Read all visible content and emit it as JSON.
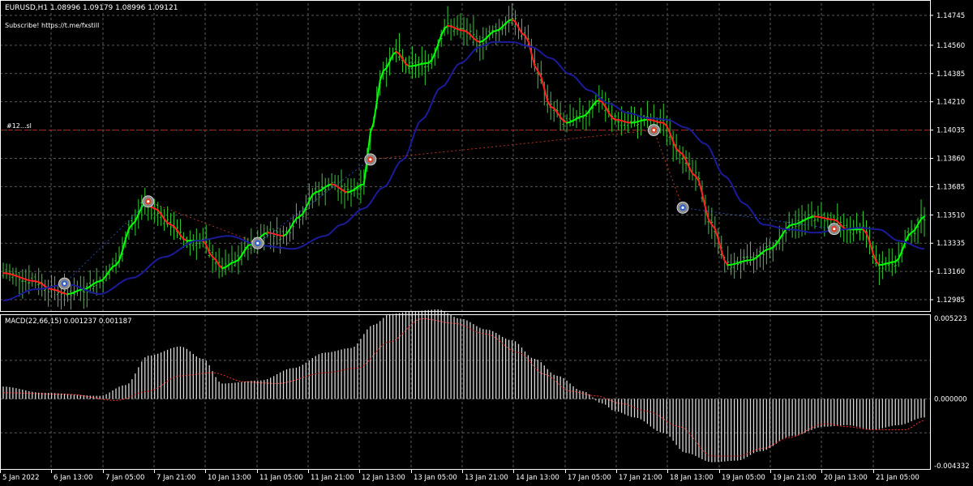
{
  "header": {
    "symbol_line": "EURUSD,H1  1.08996 1.09179 1.08996 1.09121",
    "subscribe_text": "Subscribe! https://t.me/fxstill"
  },
  "level": {
    "label": "#12...sl",
    "price": 1.14035
  },
  "colors": {
    "background": "#000000",
    "grid": "#5a5a5a",
    "bars": "#33cc33",
    "up_line": "#00ff00",
    "down_line": "#ff2020",
    "ma": "#1b1b9a",
    "macd_hist": "#d8d8d8",
    "signal": "#ff3030",
    "level": "#b02020",
    "sell_marker": "#e04020",
    "buy_marker": "#3060d0"
  },
  "chart_data": [
    {
      "type": "line",
      "title": "EURUSD,H1",
      "ylim": [
        1.1291,
        1.1482
      ],
      "y_ticks": [
        1.14745,
        1.1456,
        1.14385,
        1.1421,
        1.14035,
        1.1386,
        1.13685,
        1.1351,
        1.13335,
        1.1316,
        1.12985
      ],
      "y_tick_labels": [
        "1.14745",
        "1.14560",
        "1.14385",
        "1.14210",
        "1.14035",
        "1.13860",
        "1.13685",
        "1.13510",
        "1.13335",
        "1.13160",
        "1.12985"
      ],
      "x_ticks": [
        "5 Jan 2022",
        "6 Jan 13:00",
        "7 Jan 05:00",
        "7 Jan 21:00",
        "10 Jan 13:00",
        "11 Jan 05:00",
        "11 Jan 21:00",
        "12 Jan 13:00",
        "13 Jan 05:00",
        "13 Jan 21:00",
        "14 Jan 13:00",
        "17 Jan 05:00",
        "17 Jan 21:00",
        "18 Jan 13:00",
        "19 Jan 05:00",
        "19 Jan 21:00",
        "20 Jan 13:00",
        "21 Jan 05:00"
      ],
      "x_tick_index": [
        0,
        16,
        32,
        48,
        64,
        80,
        96,
        112,
        128,
        144,
        160,
        176,
        192,
        208,
        224,
        240,
        256,
        272
      ],
      "n_bars": 287,
      "series": [
        {
          "key": "smooth_price",
          "knots_index": [
            0,
            10,
            15,
            20,
            25,
            30,
            35,
            40,
            44,
            47,
            52,
            57,
            62,
            65,
            68,
            72,
            77,
            82,
            87,
            92,
            97,
            102,
            107,
            112,
            114,
            118,
            122,
            126,
            132,
            138,
            143,
            148,
            153,
            158,
            162,
            166,
            170,
            175,
            180,
            185,
            190,
            195,
            200,
            205,
            210,
            215,
            220,
            225,
            232,
            238,
            245,
            252,
            258,
            262,
            267,
            272,
            277,
            282,
            286
          ],
          "knots_value": [
            1.1315,
            1.131,
            1.1305,
            1.1302,
            1.1305,
            1.131,
            1.132,
            1.1345,
            1.1358,
            1.1355,
            1.1345,
            1.1335,
            1.1335,
            1.1325,
            1.1318,
            1.1322,
            1.1333,
            1.134,
            1.1338,
            1.135,
            1.1365,
            1.137,
            1.1365,
            1.137,
            1.1402,
            1.144,
            1.1452,
            1.1443,
            1.1445,
            1.1468,
            1.1465,
            1.1458,
            1.1465,
            1.1472,
            1.1462,
            1.144,
            1.1418,
            1.1408,
            1.1412,
            1.1422,
            1.141,
            1.1408,
            1.141,
            1.1408,
            1.139,
            1.1375,
            1.1345,
            1.132,
            1.1323,
            1.133,
            1.1345,
            1.135,
            1.1348,
            1.1342,
            1.1342,
            1.132,
            1.1322,
            1.134,
            1.135
          ]
        },
        {
          "key": "moving_average",
          "knots_index": [
            0,
            10,
            20,
            30,
            40,
            50,
            60,
            70,
            80,
            90,
            100,
            105,
            112,
            118,
            124,
            130,
            136,
            142,
            148,
            152,
            158,
            164,
            170,
            176,
            182,
            188,
            194,
            200,
            206,
            212,
            218,
            224,
            230,
            236,
            244,
            252,
            260,
            266,
            272,
            278,
            286
          ],
          "knots_value": [
            1.1298,
            1.1305,
            1.1308,
            1.1302,
            1.1312,
            1.1325,
            1.1335,
            1.1338,
            1.1332,
            1.133,
            1.1338,
            1.1345,
            1.1355,
            1.1368,
            1.1385,
            1.141,
            1.143,
            1.1445,
            1.1455,
            1.1458,
            1.1458,
            1.1455,
            1.1448,
            1.1438,
            1.1428,
            1.142,
            1.1414,
            1.1411,
            1.141,
            1.1405,
            1.1395,
            1.1375,
            1.1358,
            1.1345,
            1.1342,
            1.134,
            1.1342,
            1.1343,
            1.1342,
            1.1335,
            1.133
          ]
        }
      ],
      "markers": [
        {
          "kind": "buy",
          "index": 19,
          "value": 1.13085
        },
        {
          "kind": "sell",
          "index": 45,
          "value": 1.13593
        },
        {
          "kind": "buy",
          "index": 79,
          "value": 1.13335
        },
        {
          "kind": "sell",
          "index": 114,
          "value": 1.13853
        },
        {
          "kind": "sell",
          "index": 202,
          "value": 1.14035
        },
        {
          "kind": "buy",
          "index": 211,
          "value": 1.13555
        },
        {
          "kind": "sell",
          "index": 258,
          "value": 1.13423
        }
      ]
    },
    {
      "type": "bar",
      "title": "MACD(22,66,15) 0.001237 0.001187",
      "ylim": [
        -0.004332,
        0.005223
      ],
      "y_ticks": [
        0.005223,
        0.0,
        -0.004332
      ],
      "y_tick_labels": [
        "0.005223",
        "0.000000",
        "-0.004332"
      ],
      "series": [
        {
          "key": "macd_hist",
          "knots_index": [
            0,
            12,
            30,
            38,
            45,
            55,
            62,
            68,
            80,
            90,
            100,
            108,
            115,
            120,
            128,
            135,
            142,
            150,
            158,
            165,
            172,
            180,
            186,
            190,
            196,
            205,
            212,
            220,
            228,
            235,
            245,
            255,
            262,
            270,
            278,
            286
          ],
          "knots_value": [
            0.0008,
            0.0004,
            0.0002,
            0.0009,
            0.0028,
            0.0034,
            0.0026,
            0.001,
            0.0012,
            0.002,
            0.003,
            0.0033,
            0.0048,
            0.0055,
            0.0057,
            0.0058,
            0.0052,
            0.0045,
            0.0038,
            0.0026,
            0.0015,
            0.0005,
            -0.0003,
            -0.0008,
            -0.0012,
            -0.0022,
            -0.0035,
            -0.0041,
            -0.004,
            -0.0034,
            -0.0024,
            -0.0018,
            -0.0017,
            -0.002,
            -0.0017,
            -0.0012
          ]
        },
        {
          "key": "signal",
          "knots_index": [
            0,
            20,
            35,
            45,
            55,
            65,
            75,
            85,
            100,
            110,
            120,
            130,
            140,
            150,
            160,
            168,
            176,
            184,
            192,
            200,
            210,
            220,
            228,
            236,
            244,
            255,
            262,
            270,
            280,
            286
          ],
          "knots_value": [
            0.0004,
            0.0003,
            -0.0001,
            0.0005,
            0.0015,
            0.0017,
            0.0011,
            0.001,
            0.0017,
            0.002,
            0.0037,
            0.0052,
            0.0049,
            0.0042,
            0.003,
            0.0016,
            0.0005,
            0.0002,
            -0.0003,
            -0.0008,
            -0.0018,
            -0.0037,
            -0.0037,
            -0.0032,
            -0.0025,
            -0.0016,
            -0.0018,
            -0.002,
            -0.002,
            -0.0014
          ]
        }
      ]
    }
  ]
}
